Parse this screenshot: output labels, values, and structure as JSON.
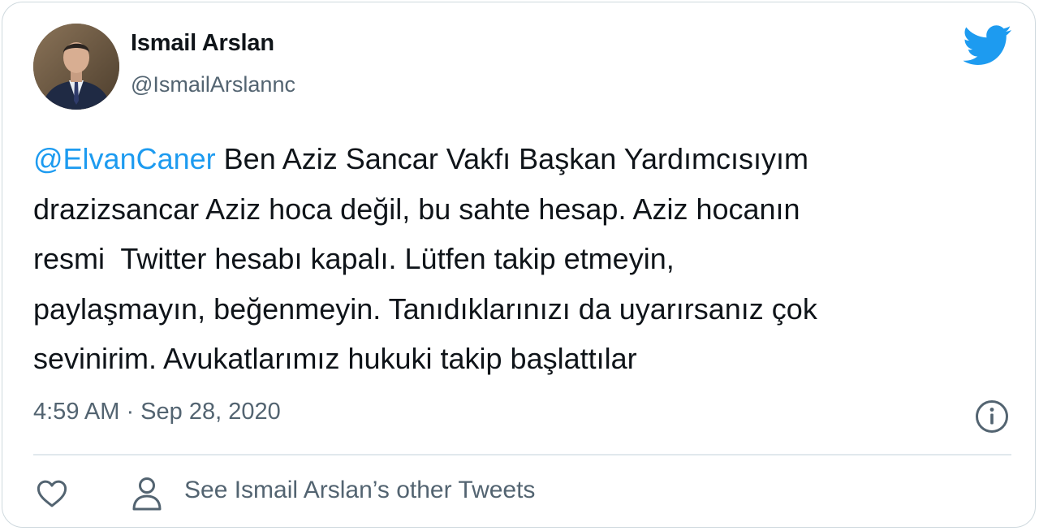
{
  "author": {
    "name": "Ismail Arslan",
    "handle": "@IsmailArslannc"
  },
  "tweet": {
    "mention": "@ElvanCaner",
    "lines": [
      " Ben Aziz Sancar Vakfı Başkan Yardımcısıyım",
      "drazizsancar Aziz hoca değil, bu sahte hesap. Aziz hocanın",
      "resmi  Twitter hesabı kapalı. Lütfen takip etmeyin,",
      "paylaşmayın, beğenmeyin. Tanıdıklarınızı da uyarırsanız çok",
      "sevinirim. Avukatlarımız hukuki takip başlattılar"
    ],
    "timestamp": "4:59 AM · Sep 28, 2020"
  },
  "actions": {
    "see_other_tweets": "See Ismail Arslan’s other Tweets"
  },
  "icons": {
    "brand": "twitter-bird-icon",
    "info": "info-icon",
    "like": "heart-icon",
    "profile": "user-icon"
  },
  "colors": {
    "accent": "#1d9bf0",
    "text": "#0f1419",
    "secondary": "#536471",
    "border": "#cfd9de"
  }
}
